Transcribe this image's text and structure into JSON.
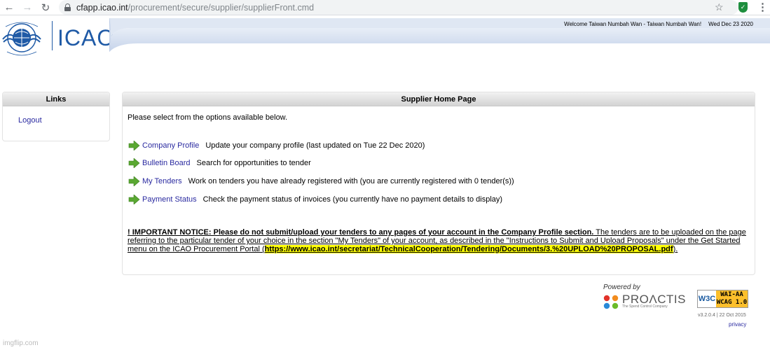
{
  "browser": {
    "url_host": "cfapp.icao.int",
    "url_path": "/procurement/secure/supplier/supplierFront.cmd"
  },
  "header": {
    "logo_text": "ICAO",
    "welcome": "Welcome Taiwan Numbah Wan - Taiwan Numbah Wan!",
    "date": "Wed Dec 23 2020"
  },
  "links_panel": {
    "title": "Links",
    "logout": "Logout"
  },
  "main": {
    "title": "Supplier Home Page",
    "intro": "Please select from the options available below.",
    "options": [
      {
        "link": "Company Profile",
        "desc": "Update your company profile (last updated on Tue 22 Dec 2020)"
      },
      {
        "link": "Bulletin Board",
        "desc": "Search for opportunities to tender"
      },
      {
        "link": "My Tenders",
        "desc": "Work on tenders you have already registered with (you are currently registered with 0 tender(s))"
      },
      {
        "link": "Payment Status",
        "desc": "Check the payment status of invoices (you currently have no payment details to display)"
      }
    ],
    "notice_bold": "! IMPORTANT NOTICE: Please do not submit/upload your tenders to any pages of your account in the Company Profile section.",
    "notice_text": " The tenders are to be uploaded on the page referring to the particular tender of your choice in the section \"My Tenders\" of your account, as described in the \"Instructions to Submit and Upload Proposals\" under the Get Started menu on the ICAO Procurement Portal (",
    "notice_url": "https://www.icao.int/secretariat/TechnicalCooperation/Tendering/Documents/3.%20UPLOAD%20PROPOSAL.pdf",
    "notice_end": ")."
  },
  "footer": {
    "powered_by": "Powered by",
    "proactis": "PROΛCTIS",
    "proactis_tagline": "The Spend Control Company",
    "w3c": "W3C",
    "wai_line1": "WAI-AA",
    "wai_line2": "WCAG 1.0",
    "version": "v3.2.0.4 | 22 Oct 2015",
    "privacy": "privacy"
  },
  "watermark": "imgflip.com",
  "colors": {
    "link": "#2a2aa0",
    "icao_blue": "#1f5aa6",
    "arrow_green": "#5aa832",
    "highlight": "#ffff00"
  }
}
